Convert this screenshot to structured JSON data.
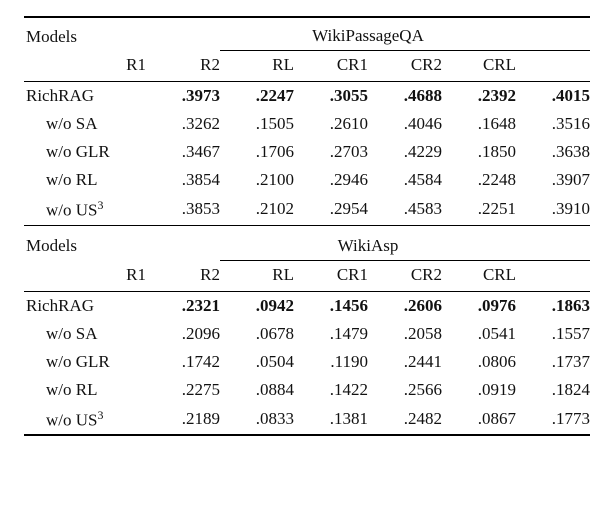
{
  "labels": {
    "models": "Models",
    "header_cols": [
      "R1",
      "R2",
      "RL",
      "CR1",
      "CR2",
      "CRL"
    ]
  },
  "sections": [
    {
      "title": "WikiPassageQA",
      "rows": [
        {
          "name_html": "RichRAG",
          "indent": false,
          "bold": true,
          "vals": [
            ".3973",
            ".2247",
            ".3055",
            ".4688",
            ".2392",
            ".4015"
          ]
        },
        {
          "name_html": "w/o SA",
          "indent": true,
          "bold": false,
          "vals": [
            ".3262",
            ".1505",
            ".2610",
            ".4046",
            ".1648",
            ".3516"
          ]
        },
        {
          "name_html": "w/o GLR",
          "indent": true,
          "bold": false,
          "vals": [
            ".3467",
            ".1706",
            ".2703",
            ".4229",
            ".1850",
            ".3638"
          ]
        },
        {
          "name_html": "w/o RL",
          "indent": true,
          "bold": false,
          "vals": [
            ".3854",
            ".2100",
            ".2946",
            ".4584",
            ".2248",
            ".3907"
          ]
        },
        {
          "name_html": "w/o US<sup>3</sup>",
          "indent": true,
          "bold": false,
          "vals": [
            ".3853",
            ".2102",
            ".2954",
            ".4583",
            ".2251",
            ".3910"
          ]
        }
      ]
    },
    {
      "title": "WikiAsp",
      "rows": [
        {
          "name_html": "RichRAG",
          "indent": false,
          "bold": true,
          "vals": [
            ".2321",
            ".0942",
            ".1456",
            ".2606",
            ".0976",
            ".1863"
          ]
        },
        {
          "name_html": "w/o SA",
          "indent": true,
          "bold": false,
          "vals": [
            ".2096",
            ".0678",
            ".1479",
            ".2058",
            ".0541",
            ".1557"
          ]
        },
        {
          "name_html": "w/o GLR",
          "indent": true,
          "bold": false,
          "vals": [
            ".1742",
            ".0504",
            ".1190",
            ".2441",
            ".0806",
            ".1737"
          ]
        },
        {
          "name_html": "w/o RL",
          "indent": true,
          "bold": false,
          "vals": [
            ".2275",
            ".0884",
            ".1422",
            ".2566",
            ".0919",
            ".1824"
          ]
        },
        {
          "name_html": "w/o US<sup>3</sup>",
          "indent": true,
          "bold": false,
          "vals": [
            ".2189",
            ".0833",
            ".1381",
            ".2482",
            ".0867",
            ".1773"
          ]
        }
      ]
    }
  ],
  "chart_data": {
    "type": "table",
    "datasets": [
      "WikiPassageQA",
      "WikiAsp"
    ],
    "metrics": [
      "R1",
      "R2",
      "RL",
      "CR1",
      "CR2",
      "CRL"
    ],
    "WikiPassageQA": {
      "RichRAG": [
        0.3973,
        0.2247,
        0.3055,
        0.4688,
        0.2392,
        0.4015
      ],
      "w/o SA": [
        0.3262,
        0.1505,
        0.261,
        0.4046,
        0.1648,
        0.3516
      ],
      "w/o GLR": [
        0.3467,
        0.1706,
        0.2703,
        0.4229,
        0.185,
        0.3638
      ],
      "w/o RL": [
        0.3854,
        0.21,
        0.2946,
        0.4584,
        0.2248,
        0.3907
      ],
      "w/o US3": [
        0.3853,
        0.2102,
        0.2954,
        0.4583,
        0.2251,
        0.391
      ]
    },
    "WikiAsp": {
      "RichRAG": [
        0.2321,
        0.0942,
        0.1456,
        0.2606,
        0.0976,
        0.1863
      ],
      "w/o SA": [
        0.2096,
        0.0678,
        0.1479,
        0.2058,
        0.0541,
        0.1557
      ],
      "w/o GLR": [
        0.1742,
        0.0504,
        0.119,
        0.2441,
        0.0806,
        0.1737
      ],
      "w/o RL": [
        0.2275,
        0.0884,
        0.1422,
        0.2566,
        0.0919,
        0.1824
      ],
      "w/o US3": [
        0.2189,
        0.0833,
        0.1381,
        0.2482,
        0.0867,
        0.1773
      ]
    }
  }
}
